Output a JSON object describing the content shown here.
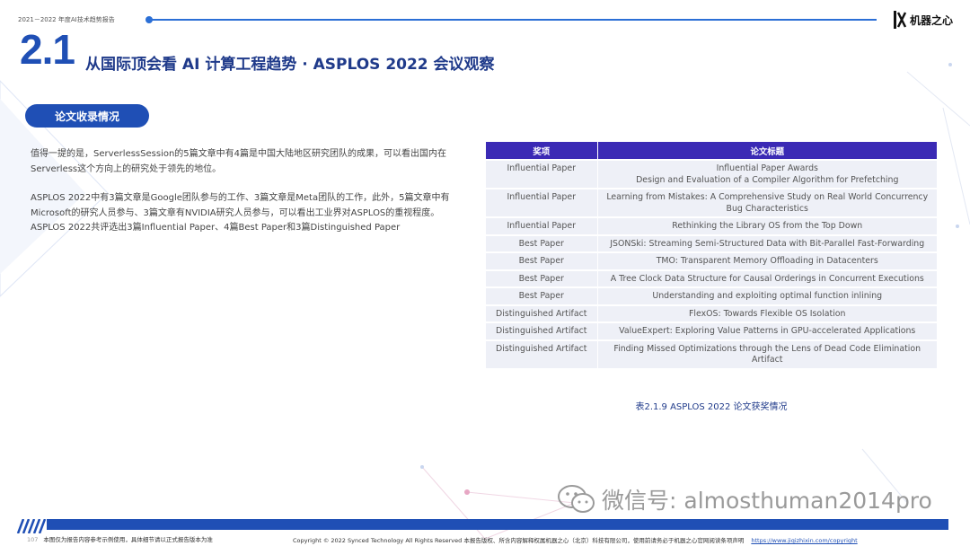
{
  "header": {
    "report_title": "2021－2022 年度AI技术趋势报告",
    "logo_text": "机器之心"
  },
  "section": {
    "number": "2.1",
    "title": "从国际顶会看 AI 计算工程趋势 · ASPLOS 2022 会议观察"
  },
  "pill_label": "论文收录情况",
  "paragraphs": [
    "值得一提的是，ServerlessSession的5篇文章中有4篇是中国大陆地区研究团队的成果，可以看出国内在Serverless这个方向上的研究处于领先的地位。",
    "ASPLOS 2022中有3篇文章是Google团队参与的工作、3篇文章是Meta团队的工作，此外，5篇文章中有Microsoft的研究人员参与、3篇文章有NVIDIA研究人员参与，可以看出工业界对ASPLOS的重视程度。",
    "ASPLOS 2022共评选出3篇Influential Paper、4篇Best Paper和3篇Distinguished Paper"
  ],
  "table": {
    "headers": [
      "奖项",
      "论文标题"
    ],
    "rows": [
      {
        "award": "Influential Paper",
        "title_lines": [
          "Influential Paper Awards",
          "Design and Evaluation of a Compiler Algorithm for Prefetching"
        ]
      },
      {
        "award": "Influential Paper",
        "title_lines": [
          "Learning from Mistakes: A Comprehensive Study on Real World Concurrency",
          "Bug Characteristics"
        ]
      },
      {
        "award": "Influential Paper",
        "title_lines": [
          "Rethinking the Library OS from the Top Down"
        ]
      },
      {
        "award": "Best Paper",
        "title_lines": [
          "JSONSki: Streaming Semi-Structured Data with Bit-Parallel Fast-Forwarding"
        ]
      },
      {
        "award": "Best Paper",
        "title_lines": [
          "TMO: Transparent Memory Offloading in Datacenters"
        ]
      },
      {
        "award": "Best Paper",
        "title_lines": [
          "A Tree Clock Data Structure for Causal Orderings in Concurrent Executions"
        ]
      },
      {
        "award": "Best Paper",
        "title_lines": [
          "Understanding and exploiting optimal function inlining"
        ]
      },
      {
        "award": "Distinguished Artifact",
        "title_lines": [
          "FlexOS: Towards Flexible OS Isolation"
        ]
      },
      {
        "award": "Distinguished Artifact",
        "title_lines": [
          "ValueExpert: Exploring Value Patterns in GPU-accelerated Applications"
        ]
      },
      {
        "award": "Distinguished Artifact",
        "title_lines": [
          "Finding Missed Optimizations through the Lens of Dead Code Elimination",
          "Artifact"
        ]
      }
    ]
  },
  "caption": "表2.1.9 ASPLOS 2022 论文获奖情况",
  "watermark": "微信号: almosthuman2014pro",
  "footer": {
    "page_number": "107",
    "left_note": "本图仅为报告内容参考示例使用，具体细节请以正式报告版本为准",
    "copyright": "Copyright © 2022 Synced Technology  All Rights Reserved   本报告版权、所含内容解释权属机器之心（北京）科技有限公司，使用前请务必于机器之心官网阅读条项声明",
    "link": "https://www.jiqizhixin.com/copyright"
  },
  "colors": {
    "brand_blue": "#1f4fb5",
    "table_header": "#3b2ab5",
    "table_row": "#eef0f7"
  }
}
